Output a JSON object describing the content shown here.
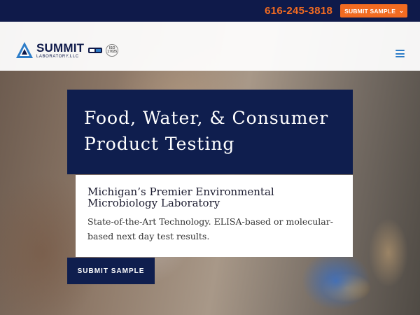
{
  "topbar": {
    "phone": "616-245-3818",
    "submit_label": "SUBMIT SAMPLE",
    "submit_chevron_icon": "chevron-down-icon"
  },
  "brand": {
    "name": "SUMMIT",
    "sub": "LABORATORY,LLC",
    "iso_badge": "ISO 17025",
    "colors": {
      "navy": "#0f1e4e",
      "orange": "#f26b21",
      "menu": "#2e7dc8"
    }
  },
  "hero": {
    "title_line1": "Food, Water, & Consumer",
    "title_line2": "Product Testing",
    "card_heading": "Michigan’s Premier Environmental Microbiology Laboratory",
    "card_body": "State-of-the-Art Technology. ELISA-based or molecular-based next day test results.",
    "cta_label": "SUBMIT SAMPLE"
  }
}
